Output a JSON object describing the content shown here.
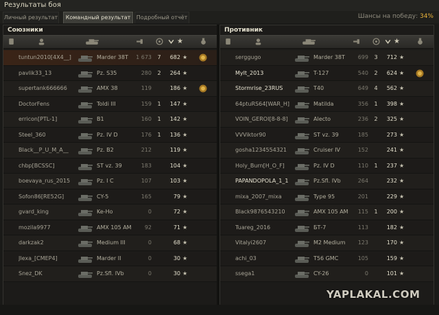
{
  "window": {
    "title": "Результаты боя"
  },
  "tabs": [
    {
      "label": "Личный результат",
      "active": false
    },
    {
      "label": "Командный результат",
      "active": true
    },
    {
      "label": "Подробный отчёт",
      "active": false
    }
  ],
  "win_chance": {
    "label": "Шансы на победу:",
    "value": "34%"
  },
  "allies": {
    "title": "Союзники",
    "rows": [
      {
        "player": "tuntun2010[4X4__]",
        "tank": "Marder 38T",
        "damage": "1 673",
        "frags": "7",
        "xp": "682",
        "medal": true,
        "me": true,
        "bright": false
      },
      {
        "player": "pavlik33_13",
        "tank": "Pz. S35",
        "damage": "280",
        "frags": "2",
        "xp": "264",
        "medal": false,
        "me": false,
        "bright": false
      },
      {
        "player": "supertank666666",
        "tank": "AMX 38",
        "damage": "119",
        "frags": "",
        "xp": "186",
        "medal": true,
        "me": false,
        "bright": false
      },
      {
        "player": "DoctorFens",
        "tank": "Toldi III",
        "damage": "159",
        "frags": "1",
        "xp": "147",
        "medal": false,
        "me": false,
        "bright": false
      },
      {
        "player": "erricon[PTL-1]",
        "tank": "B1",
        "damage": "160",
        "frags": "1",
        "xp": "142",
        "medal": false,
        "me": false,
        "bright": false
      },
      {
        "player": "Steel_360",
        "tank": "Pz. IV D",
        "damage": "176",
        "frags": "1",
        "xp": "136",
        "medal": false,
        "me": false,
        "bright": false
      },
      {
        "player": "Black__P_U_M_A__",
        "tank": "Pz. B2",
        "damage": "212",
        "frags": "",
        "xp": "119",
        "medal": false,
        "me": false,
        "bright": false
      },
      {
        "player": "chbp[BCSSC]",
        "tank": "ST vz. 39",
        "damage": "183",
        "frags": "",
        "xp": "104",
        "medal": false,
        "me": false,
        "bright": false
      },
      {
        "player": "boevaya_rus_2015",
        "tank": "Pz. I C",
        "damage": "107",
        "frags": "",
        "xp": "103",
        "medal": false,
        "me": false,
        "bright": false
      },
      {
        "player": "Sofon86[RE52G]",
        "tank": "CY-5",
        "damage": "165",
        "frags": "",
        "xp": "79",
        "medal": false,
        "me": false,
        "bright": false
      },
      {
        "player": "gvard_king",
        "tank": "Ke-Ho",
        "damage": "0",
        "frags": "",
        "xp": "72",
        "medal": false,
        "me": false,
        "bright": false
      },
      {
        "player": "mozila9977",
        "tank": "AMX 105 AM",
        "damage": "92",
        "frags": "",
        "xp": "71",
        "medal": false,
        "me": false,
        "bright": false
      },
      {
        "player": "darkzak2",
        "tank": "Medium III",
        "damage": "0",
        "frags": "",
        "xp": "68",
        "medal": false,
        "me": false,
        "bright": false
      },
      {
        "player": "Jlexa_[CMEP4]",
        "tank": "Marder II",
        "damage": "0",
        "frags": "",
        "xp": "30",
        "medal": false,
        "me": false,
        "bright": false
      },
      {
        "player": "Snez_DK",
        "tank": "Pz.Sfl. IVb",
        "damage": "0",
        "frags": "",
        "xp": "30",
        "medal": false,
        "me": false,
        "bright": false
      }
    ]
  },
  "enemies": {
    "title": "Противник",
    "rows": [
      {
        "player": "serggugo",
        "tank": "Marder 38T",
        "damage": "699",
        "frags": "3",
        "xp": "712",
        "medal": false,
        "bright": false
      },
      {
        "player": "Mylt_2013",
        "tank": "T-127",
        "damage": "540",
        "frags": "2",
        "xp": "624",
        "medal": true,
        "bright": true
      },
      {
        "player": "Stormrise_23RUS",
        "tank": "T40",
        "damage": "649",
        "frags": "4",
        "xp": "562",
        "medal": false,
        "bright": true
      },
      {
        "player": "64ptuRS64[WAR_H]",
        "tank": "Matilda",
        "damage": "356",
        "frags": "1",
        "xp": "398",
        "medal": false,
        "bright": false
      },
      {
        "player": "VOIN_GEROI[8-8-8]",
        "tank": "Alecto",
        "damage": "236",
        "frags": "2",
        "xp": "325",
        "medal": false,
        "bright": false
      },
      {
        "player": "VVViktor90",
        "tank": "ST vz. 39",
        "damage": "185",
        "frags": "",
        "xp": "273",
        "medal": false,
        "bright": false
      },
      {
        "player": "gosha1234554321",
        "tank": "Cruiser IV",
        "damage": "152",
        "frags": "",
        "xp": "241",
        "medal": false,
        "bright": false
      },
      {
        "player": "Holy_Burn[H_O_F]",
        "tank": "Pz. IV D",
        "damage": "110",
        "frags": "1",
        "xp": "237",
        "medal": false,
        "bright": false
      },
      {
        "player": "PAPANDOPOLA_1_1",
        "tank": "Pz.Sfl. IVb",
        "damage": "264",
        "frags": "",
        "xp": "232",
        "medal": false,
        "bright": true
      },
      {
        "player": "mixa_2007_mixa",
        "tank": "Type 95",
        "damage": "201",
        "frags": "",
        "xp": "229",
        "medal": false,
        "bright": false
      },
      {
        "player": "Black9876543210",
        "tank": "AMX 105 AM",
        "damage": "115",
        "frags": "1",
        "xp": "200",
        "medal": false,
        "bright": false
      },
      {
        "player": "Tuareg_2016",
        "tank": "БТ-7",
        "damage": "113",
        "frags": "",
        "xp": "182",
        "medal": false,
        "bright": false
      },
      {
        "player": "Vitalyi2607",
        "tank": "M2 Medium",
        "damage": "123",
        "frags": "",
        "xp": "170",
        "medal": false,
        "bright": false
      },
      {
        "player": "achi_03",
        "tank": "T56 GMC",
        "damage": "105",
        "frags": "",
        "xp": "159",
        "medal": false,
        "bright": false
      },
      {
        "player": "ssega1",
        "tank": "CY-26",
        "damage": "0",
        "frags": "",
        "xp": "101",
        "medal": false,
        "bright": false
      }
    ]
  },
  "watermark": "YAPLAKAL.COM",
  "icons": {
    "star": "★",
    "header": [
      "platoon-icon",
      "player-icon",
      "tank-icon",
      "damage-icon",
      "frags-icon",
      "xp-icon",
      "star-icon",
      "medal-icon"
    ]
  },
  "colors": {
    "accent": "#e8b13a",
    "me_row": "#3a2417"
  }
}
